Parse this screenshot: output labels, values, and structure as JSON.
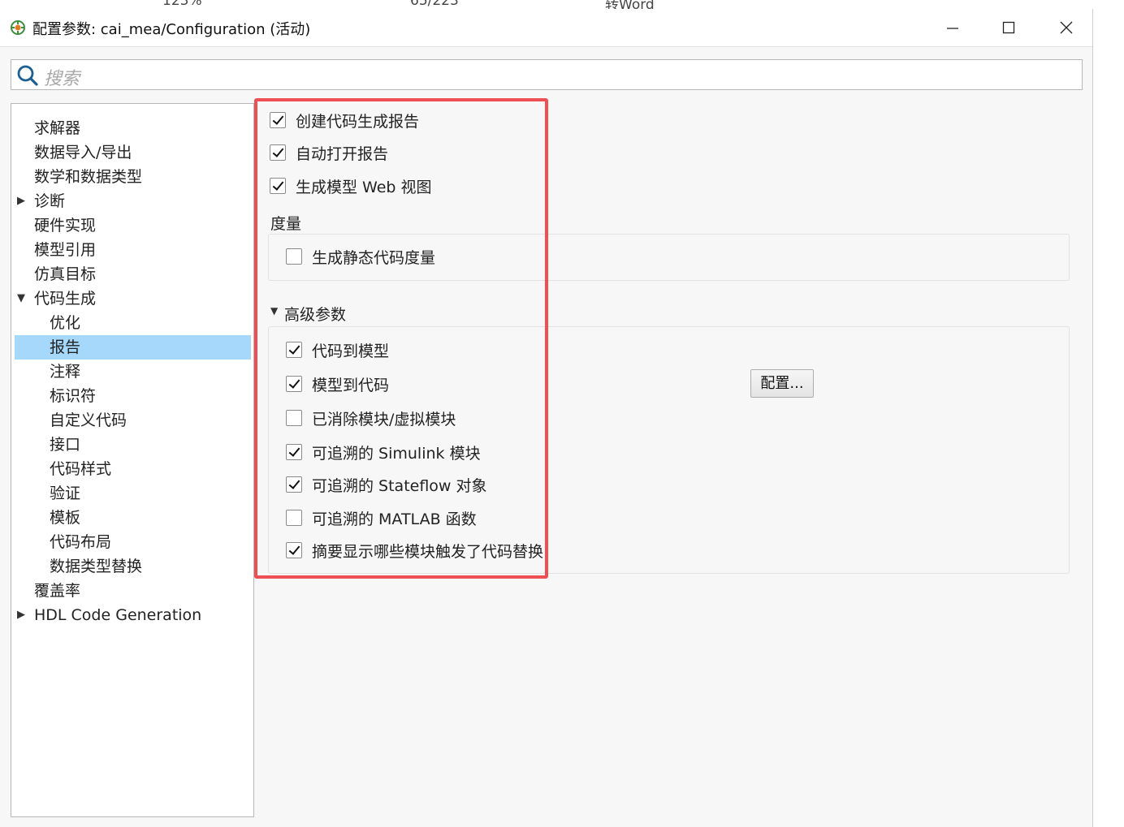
{
  "window": {
    "title": "配置参数: cai_mea/Configuration (活动)"
  },
  "search": {
    "placeholder": "搜索"
  },
  "tree": {
    "items": [
      {
        "label": "求解器",
        "level": 0,
        "arrow": ""
      },
      {
        "label": "数据导入/导出",
        "level": 0,
        "arrow": ""
      },
      {
        "label": "数学和数据类型",
        "level": 0,
        "arrow": ""
      },
      {
        "label": "诊断",
        "level": 0,
        "arrow": "▶"
      },
      {
        "label": "硬件实现",
        "level": 0,
        "arrow": ""
      },
      {
        "label": "模型引用",
        "level": 0,
        "arrow": ""
      },
      {
        "label": "仿真目标",
        "level": 0,
        "arrow": ""
      },
      {
        "label": "代码生成",
        "level": 0,
        "arrow": "▼"
      },
      {
        "label": "优化",
        "level": 1,
        "arrow": ""
      },
      {
        "label": "报告",
        "level": 1,
        "arrow": "",
        "selected": true
      },
      {
        "label": "注释",
        "level": 1,
        "arrow": ""
      },
      {
        "label": "标识符",
        "level": 1,
        "arrow": ""
      },
      {
        "label": "自定义代码",
        "level": 1,
        "arrow": ""
      },
      {
        "label": "接口",
        "level": 1,
        "arrow": ""
      },
      {
        "label": "代码样式",
        "level": 1,
        "arrow": ""
      },
      {
        "label": "验证",
        "level": 1,
        "arrow": ""
      },
      {
        "label": "模板",
        "level": 1,
        "arrow": ""
      },
      {
        "label": "代码布局",
        "level": 1,
        "arrow": ""
      },
      {
        "label": "数据类型替换",
        "level": 1,
        "arrow": ""
      },
      {
        "label": "覆盖率",
        "level": 0,
        "arrow": ""
      },
      {
        "label": "HDL Code Generation",
        "level": 0,
        "arrow": "▶"
      }
    ]
  },
  "report": {
    "create_report": {
      "label": "创建代码生成报告",
      "checked": true
    },
    "open_report": {
      "label": "自动打开报告",
      "checked": true
    },
    "web_view": {
      "label": "生成模型 Web 视图",
      "checked": true
    },
    "metrics_label": "度量",
    "static_metrics": {
      "label": "生成静态代码度量",
      "checked": false
    },
    "advanced_label": "高级参数",
    "advanced_arrow": "▼",
    "advanced": [
      {
        "label": "代码到模型",
        "checked": true
      },
      {
        "label": "模型到代码",
        "checked": true
      },
      {
        "label": "已消除模块/虚拟模块",
        "checked": false
      },
      {
        "label": "可追溯的 Simulink 模块",
        "checked": true
      },
      {
        "label": "可追溯的 Stateflow 对象",
        "checked": true
      },
      {
        "label": "可追溯的 MATLAB 函数",
        "checked": false
      },
      {
        "label": "摘要显示哪些模块触发了代码替换",
        "checked": true
      }
    ],
    "configure_button": "配置..."
  }
}
